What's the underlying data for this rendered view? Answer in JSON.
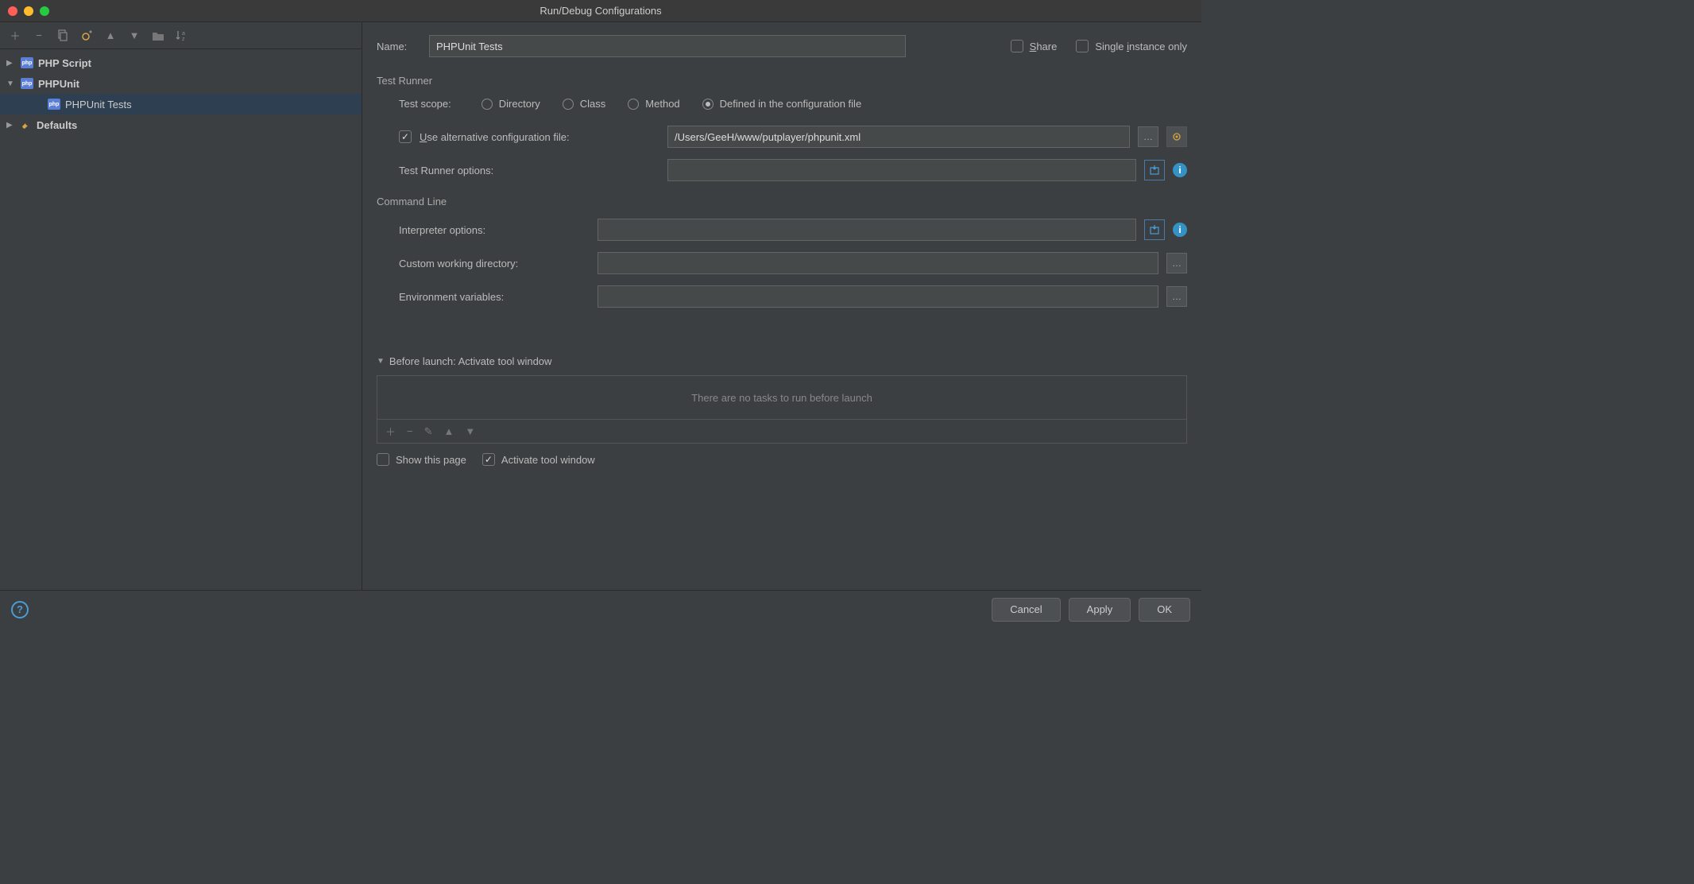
{
  "title": "Run/Debug Configurations",
  "tree": {
    "php_script": "PHP Script",
    "phpunit": "PHPUnit",
    "phpunit_tests": "PHPUnit Tests",
    "defaults": "Defaults"
  },
  "form": {
    "name_label": "Name:",
    "name_value": "PHPUnit Tests",
    "share_label": "Share",
    "single_instance_label": "Single instance only"
  },
  "test_runner": {
    "section": "Test Runner",
    "scope_label": "Test scope:",
    "options": {
      "directory": "Directory",
      "class": "Class",
      "method": "Method",
      "defined": "Defined in the configuration file"
    },
    "use_alt_label": "Use alternative configuration file:",
    "alt_file_value": "/Users/GeeH/www/putplayer/phpunit.xml",
    "runner_options_label": "Test Runner options:",
    "runner_options_value": ""
  },
  "command_line": {
    "section": "Command Line",
    "interpreter_label": "Interpreter options:",
    "interpreter_value": "",
    "cwd_label": "Custom working directory:",
    "cwd_value": "",
    "env_label": "Environment variables:",
    "env_value": ""
  },
  "before_launch": {
    "header": "Before launch: Activate tool window",
    "empty_text": "There are no tasks to run before launch",
    "show_page_label": "Show this page",
    "activate_label": "Activate tool window"
  },
  "buttons": {
    "cancel": "Cancel",
    "apply": "Apply",
    "ok": "OK"
  }
}
